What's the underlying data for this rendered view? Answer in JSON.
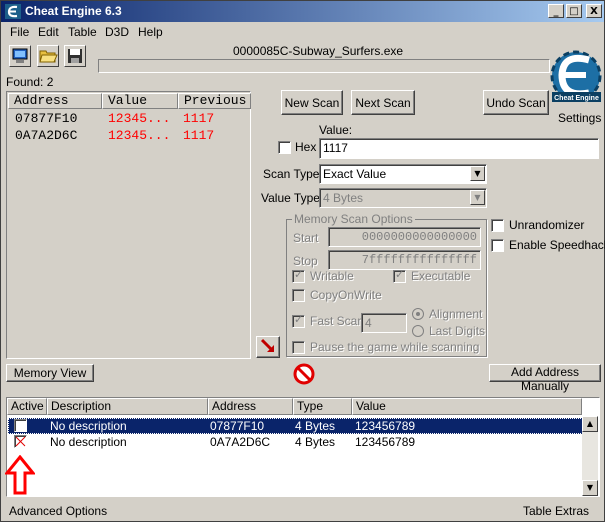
{
  "window": {
    "title": "Cheat Engine 6.3",
    "minimize": "_",
    "maximize": "□",
    "close": "X"
  },
  "menu": [
    "File",
    "Edit",
    "Table",
    "D3D",
    "Help"
  ],
  "process": {
    "title": "0000085C-Subway_Surfers.exe"
  },
  "found": "Found: 2",
  "results": {
    "headers": [
      "Address",
      "Value",
      "Previous"
    ],
    "rows": [
      {
        "address": "07877F10",
        "value": "12345...",
        "previous": "1117"
      },
      {
        "address": "0A7A2D6C",
        "value": "12345...",
        "previous": "1117"
      }
    ]
  },
  "buttons": {
    "new_scan": "New Scan",
    "next_scan": "Next Scan",
    "undo_scan": "Undo Scan",
    "memory_view": "Memory View",
    "add_address": "Add Address Manually"
  },
  "settings": "Settings",
  "logo_text": "Cheat Engine",
  "scan": {
    "value_label": "Value:",
    "hex_label": "Hex",
    "value": "1117",
    "scan_type_label": "Scan Type",
    "scan_type": "Exact Value",
    "value_type_label": "Value Type",
    "value_type": "4 Bytes"
  },
  "memory_options": {
    "title": "Memory Scan Options",
    "start_label": "Start",
    "start": "0000000000000000",
    "stop_label": "Stop",
    "stop": "7fffffffffffffff",
    "writable": "Writable",
    "executable": "Executable",
    "copy_on_write": "CopyOnWrite",
    "fast_scan": "Fast Scan",
    "fast_scan_value": "4",
    "alignment": "Alignment",
    "last_digits": "Last Digits",
    "pause": "Pause the game while scanning"
  },
  "extra_options": {
    "unrandomizer": "Unrandomizer",
    "speedhack": "Enable Speedhack"
  },
  "table": {
    "headers": [
      "Active",
      "Description",
      "Address",
      "Type",
      "Value"
    ],
    "rows": [
      {
        "description": "No description",
        "address": "07877F10",
        "type": "4 Bytes",
        "value": "123456789"
      },
      {
        "description": "No description",
        "address": "0A7A2D6C",
        "type": "4 Bytes",
        "value": "123456789"
      }
    ]
  },
  "footer": {
    "left": "Advanced Options",
    "right": "Table Extras"
  },
  "colors": {
    "title_start": "#0a246a",
    "title_end": "#a6caf0",
    "changed_value": "#ff0000",
    "selection": "#0a246a",
    "annotation_arrow": "#ff0000"
  }
}
